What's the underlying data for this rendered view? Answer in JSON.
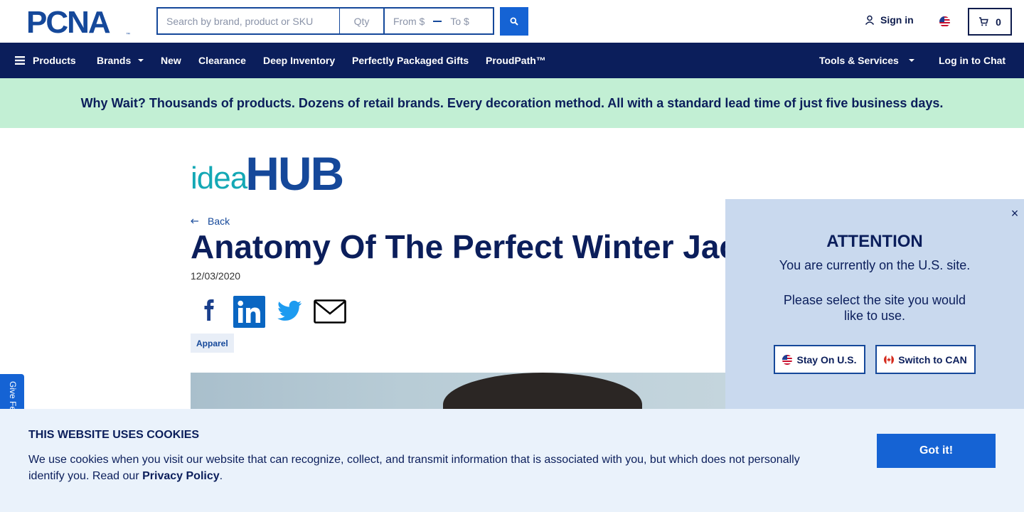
{
  "header": {
    "logo_text": "PCNA",
    "logo_tm": "™",
    "search_placeholder": "Search by brand, product or SKU",
    "qty_placeholder": "Qty",
    "price_from": "From $",
    "price_to": "To $",
    "sign_in": "Sign in",
    "cart_count": "0"
  },
  "nav": {
    "items": [
      {
        "label": "Products"
      },
      {
        "label": "Brands"
      },
      {
        "label": "New"
      },
      {
        "label": "Clearance"
      },
      {
        "label": "Deep Inventory"
      },
      {
        "label": "Perfectly Packaged Gifts"
      },
      {
        "label": "ProudPath™"
      }
    ],
    "tools": "Tools & Services",
    "chat": "Log in to Chat"
  },
  "promo": {
    "text": "Why Wait? Thousands of products. Dozens of retail brands. Every decoration method. All with a standard lead time of just five business days."
  },
  "article": {
    "brand_idea": "idea",
    "brand_hub": "HUB",
    "back": "Back",
    "title": "Anatomy Of The Perfect Winter Jacket",
    "date": "12/03/2020",
    "tag": "Apparel"
  },
  "feedback": {
    "label": "Give Feedback"
  },
  "popup": {
    "title": "ATTENTION",
    "line1": "You are currently on the U.S. site.",
    "line2": "Please select the site you would like to use.",
    "stay": "Stay On U.S.",
    "switch": "Switch to CAN",
    "close": "×"
  },
  "cookie": {
    "title": "THIS WEBSITE USES COOKIES",
    "text_before": "We use cookies when you visit our website that can recognize, collect, and transmit information that is associated with you, but which does not personally identify you. Read our",
    "link": "Privacy Policy",
    "text_after": ".",
    "button": "Got it!"
  },
  "colors": {
    "navy": "#0b1e5b",
    "brand_blue": "#15489a",
    "action_blue": "#1563d4",
    "promo_green": "#c2efd4",
    "popup_bg": "#c9d9ee",
    "cookie_bg": "#eaf2fb"
  }
}
